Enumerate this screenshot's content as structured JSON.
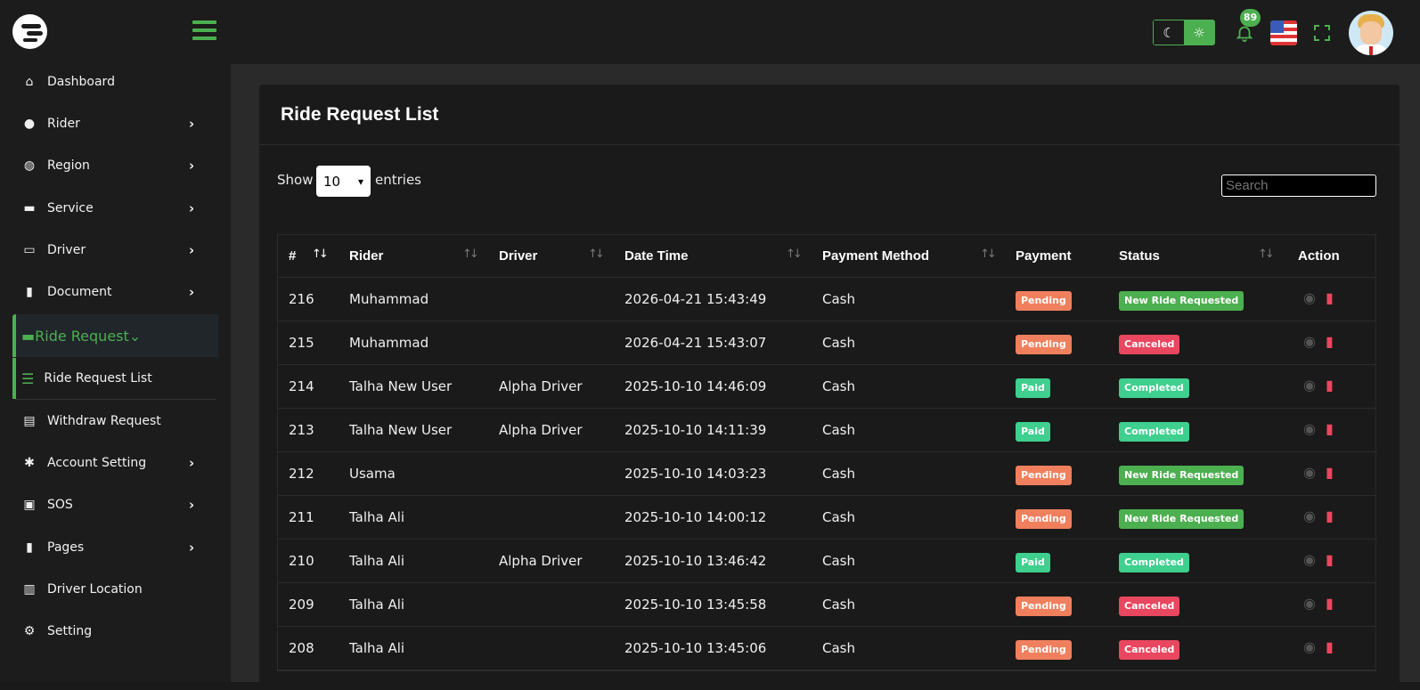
{
  "header": {
    "notifications_count": "89",
    "theme_modes": [
      "dark",
      "light"
    ],
    "accent_color": "#4caf50"
  },
  "sidebar": {
    "items": [
      {
        "label": "Dashboard",
        "icon": "home-icon",
        "has_children": false
      },
      {
        "label": "Rider",
        "icon": "user-icon",
        "has_children": true
      },
      {
        "label": "Region",
        "icon": "globe-icon",
        "has_children": true
      },
      {
        "label": "Service",
        "icon": "car-icon",
        "has_children": true
      },
      {
        "label": "Driver",
        "icon": "id-card-icon",
        "has_children": true
      },
      {
        "label": "Document",
        "icon": "file-icon",
        "has_children": true
      },
      {
        "label": "Ride Request",
        "icon": "car-side-icon",
        "has_children": true,
        "active": true
      },
      {
        "label": "Ride Request List",
        "icon": "list-icon",
        "sub": true,
        "active": true
      },
      {
        "label": "Withdraw Request",
        "icon": "money-check-icon",
        "has_children": false
      },
      {
        "label": "Account Setting",
        "icon": "users-cog-icon",
        "has_children": true
      },
      {
        "label": "SOS",
        "icon": "address-book-icon",
        "has_children": true
      },
      {
        "label": "Pages",
        "icon": "page-icon",
        "has_children": true
      },
      {
        "label": "Driver Location",
        "icon": "map-icon",
        "has_children": false
      },
      {
        "label": "Setting",
        "icon": "gear-icon",
        "has_children": false
      }
    ]
  },
  "page": {
    "title": "Ride Request List",
    "show_label": "Show",
    "entries_value": "10",
    "entries_label": "entries",
    "search_placeholder": "Search"
  },
  "table": {
    "columns": [
      "#",
      "Rider",
      "Driver",
      "Date Time",
      "Payment Method",
      "Payment",
      "Status",
      "Action"
    ],
    "rows": [
      {
        "id": "216",
        "rider": "Muhammad",
        "driver": "",
        "datetime": "2026-04-21 15:43:49",
        "method": "Cash",
        "payment": "Pending",
        "status": "New Ride Requested"
      },
      {
        "id": "215",
        "rider": "Muhammad",
        "driver": "",
        "datetime": "2026-04-21 15:43:07",
        "method": "Cash",
        "payment": "Pending",
        "status": "Canceled"
      },
      {
        "id": "214",
        "rider": "Talha New User",
        "driver": "Alpha Driver",
        "datetime": "2025-10-10 14:46:09",
        "method": "Cash",
        "payment": "Paid",
        "status": "Completed"
      },
      {
        "id": "213",
        "rider": "Talha New User",
        "driver": "Alpha Driver",
        "datetime": "2025-10-10 14:11:39",
        "method": "Cash",
        "payment": "Paid",
        "status": "Completed"
      },
      {
        "id": "212",
        "rider": "Usama",
        "driver": "",
        "datetime": "2025-10-10 14:03:23",
        "method": "Cash",
        "payment": "Pending",
        "status": "New Ride Requested"
      },
      {
        "id": "211",
        "rider": "Talha Ali",
        "driver": "",
        "datetime": "2025-10-10 14:00:12",
        "method": "Cash",
        "payment": "Pending",
        "status": "New Ride Requested"
      },
      {
        "id": "210",
        "rider": "Talha Ali",
        "driver": "Alpha Driver",
        "datetime": "2025-10-10 13:46:42",
        "method": "Cash",
        "payment": "Paid",
        "status": "Completed"
      },
      {
        "id": "209",
        "rider": "Talha Ali",
        "driver": "",
        "datetime": "2025-10-10 13:45:58",
        "method": "Cash",
        "payment": "Pending",
        "status": "Canceled"
      },
      {
        "id": "208",
        "rider": "Talha Ali",
        "driver": "",
        "datetime": "2025-10-10 13:45:06",
        "method": "Cash",
        "payment": "Pending",
        "status": "Canceled"
      }
    ]
  },
  "colors": {
    "pending": "#f07f5e",
    "paid": "#3fcf8e",
    "new_ride": "#4caf50",
    "canceled": "#e8475f",
    "completed": "#3fcf8e"
  }
}
